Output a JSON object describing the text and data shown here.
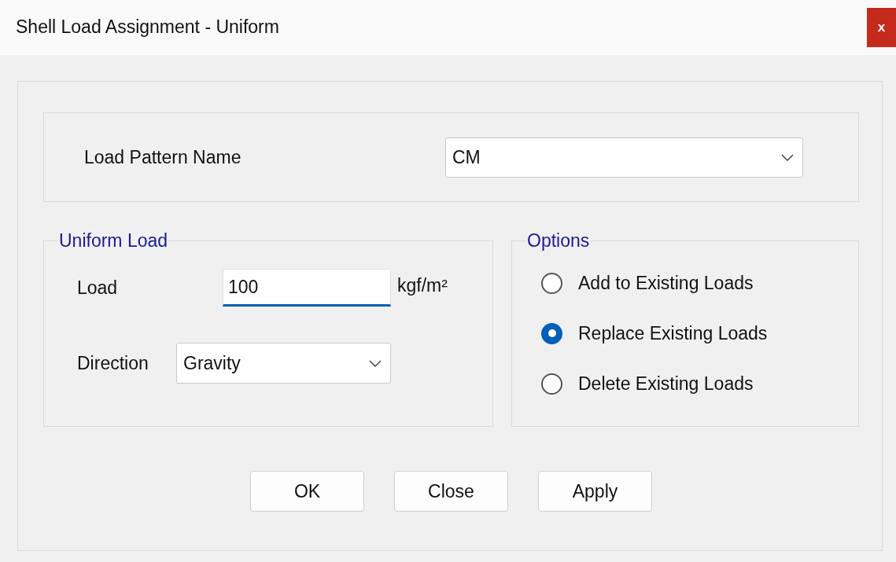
{
  "window": {
    "title": "Shell Load Assignment - Uniform",
    "close_label": "x"
  },
  "load_pattern": {
    "label": "Load Pattern Name",
    "value": "CM"
  },
  "uniform_load": {
    "title": "Uniform Load",
    "load": {
      "label": "Load",
      "value": "100",
      "unit": "kgf/m²",
      "focused": true
    },
    "direction": {
      "label": "Direction",
      "value": "Gravity"
    }
  },
  "options": {
    "title": "Options",
    "items": [
      {
        "label": "Add to Existing Loads",
        "selected": false
      },
      {
        "label": "Replace Existing Loads",
        "selected": true
      },
      {
        "label": "Delete Existing Loads",
        "selected": false
      }
    ]
  },
  "buttons": [
    "OK",
    "Close",
    "Apply"
  ]
}
